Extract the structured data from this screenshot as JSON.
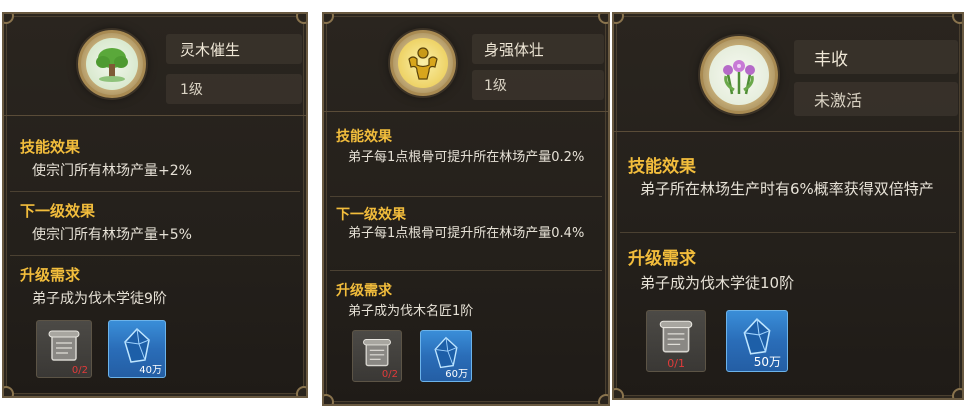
{
  "cards": [
    {
      "skill_name": "灵木催生",
      "level": "1级",
      "effect_title": "技能效果",
      "effect_text": "使宗门所有林场产量+2%",
      "next_title": "下一级效果",
      "next_text": "使宗门所有林场产量+5%",
      "req_title": "升级需求",
      "req_text": "弟子成为伐木学徒9阶",
      "items": [
        {
          "icon": "scroll-icon",
          "count": "0/2"
        },
        {
          "icon": "crystal-icon",
          "count": "40万"
        }
      ]
    },
    {
      "skill_name": "身强体壮",
      "level": "1级",
      "effect_title": "技能效果",
      "effect_text": "弟子每1点根骨可提升所在林场产量0.2%",
      "next_title": "下一级效果",
      "next_text": "弟子每1点根骨可提升所在林场产量0.4%",
      "req_title": "升级需求",
      "req_text": "弟子成为伐木名匠1阶",
      "items": [
        {
          "icon": "scroll-icon",
          "count": "0/2"
        },
        {
          "icon": "crystal-icon",
          "count": "60万"
        }
      ]
    },
    {
      "skill_name": "丰收",
      "level": "未激活",
      "effect_title": "技能效果",
      "effect_text": "弟子所在林场生产时有6%概率获得双倍特产",
      "req_title": "升级需求",
      "req_text": "弟子成为伐木学徒10阶",
      "items": [
        {
          "icon": "scroll-icon",
          "count": "0/1"
        },
        {
          "icon": "crystal-icon",
          "count": "50万"
        }
      ]
    }
  ],
  "colors": {
    "section_title": "#f2bd3c",
    "body_text": "#e6e1d6",
    "panel_bg": "#24201b",
    "requirement_missing": "#e03a3a"
  }
}
